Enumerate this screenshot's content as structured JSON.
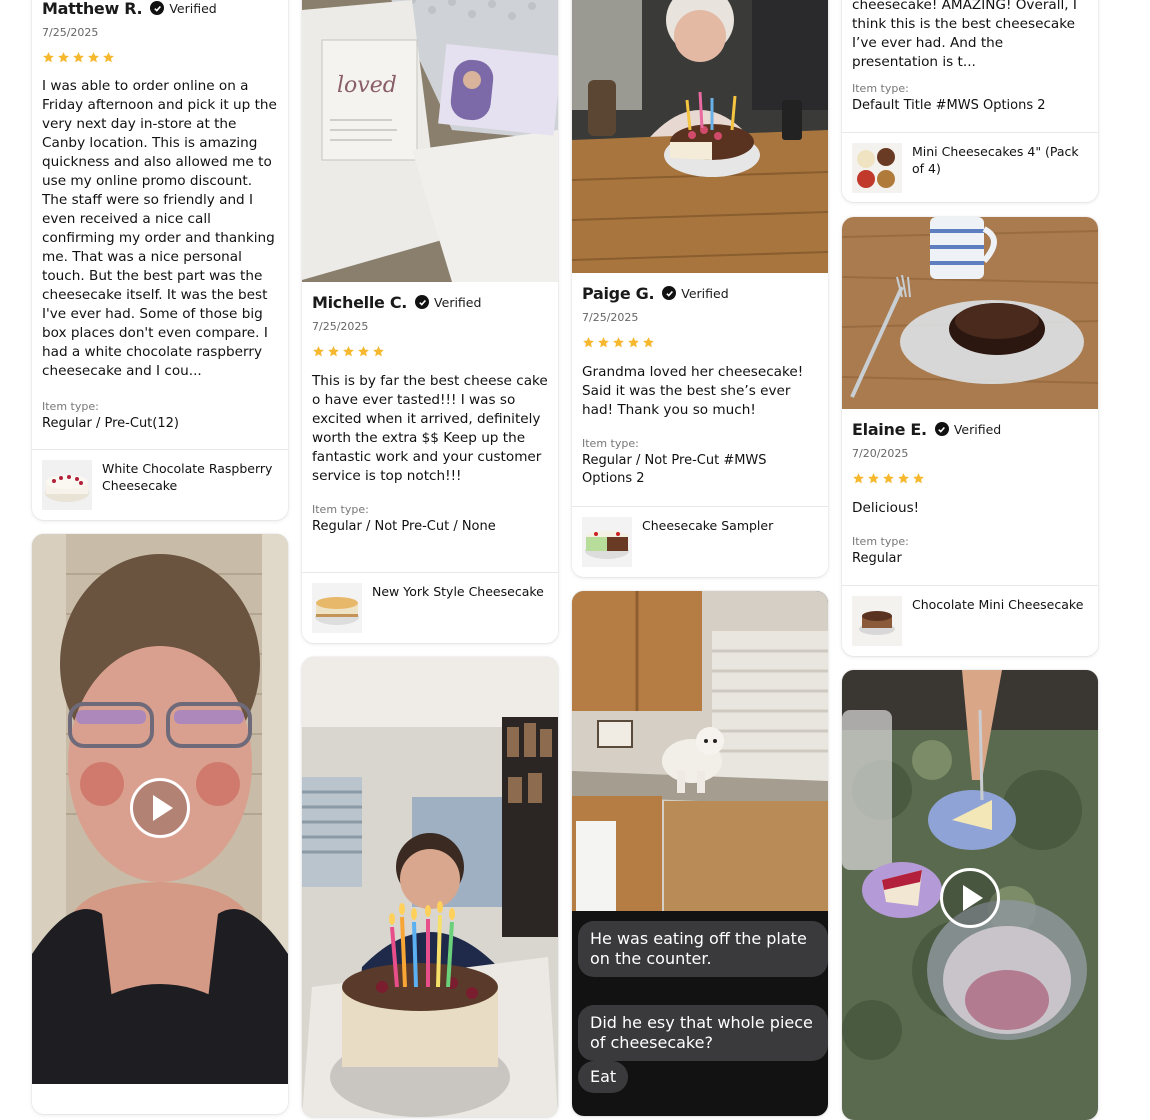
{
  "verified_label": "Verified",
  "item_type_label": "Item type:",
  "colors": {
    "star": "#f5b82e",
    "verified_check": "#111111"
  },
  "reviews": {
    "matthew": {
      "name": "Matthew R.",
      "date": "7/25/2025",
      "rating": 5,
      "text": "I was able to order online on a Friday afternoon and pick it up the very next day in-store at the Canby location. This is amazing quickness and also allowed me to use my online promo discount. The staff were so friendly and I even received a nice call confirming my order and thanking me. That was a nice personal touch. But the best part was the cheesecake itself. It was the best I've ever had. Some of those big box places don't even compare. I had a white chocolate raspberry cheesecake and I cou...",
      "item_type": "Regular / Pre-Cut(12)",
      "product": "White Chocolate Raspberry Cheesecake"
    },
    "michelle": {
      "name": "Michelle C.",
      "date": "7/25/2025",
      "rating": 5,
      "text": "This is by far the best cheese cake o have ever tasted!!! I was so excited when it arrived, definitely worth the extra $$ Keep up the fantastic work and your customer service is top notch!!!",
      "item_type": "Regular / Not Pre-Cut / None",
      "product": "New York Style Cheesecake"
    },
    "paige": {
      "name": "Paige G.",
      "date": "7/25/2025",
      "rating": 5,
      "text": "Grandma loved her cheesecake! Said it was the best she’s ever had! Thank you so much!",
      "item_type": "Regular / Not Pre-Cut #MWS Options 2",
      "product": "Cheesecake Sampler"
    },
    "top_right": {
      "text_tail": "cheesecake! AMAZING! Overall, I think this is the best cheesecake I’ve ever had. And the presentation is t...",
      "item_type": "Default Title #MWS Options 2",
      "product": "Mini Cheesecakes 4\" (Pack of 4)"
    },
    "elaine": {
      "name": "Elaine E.",
      "date": "7/20/2025",
      "rating": 5,
      "text": "Delicious!",
      "item_type": "Regular",
      "product": "Chocolate Mini Cheesecake"
    }
  },
  "photo_text": {
    "bubble_1": "He was eating off the plate on the counter.",
    "bubble_2": "Did he esy that whole piece of cheesecake?",
    "bubble_3": "Eat"
  }
}
